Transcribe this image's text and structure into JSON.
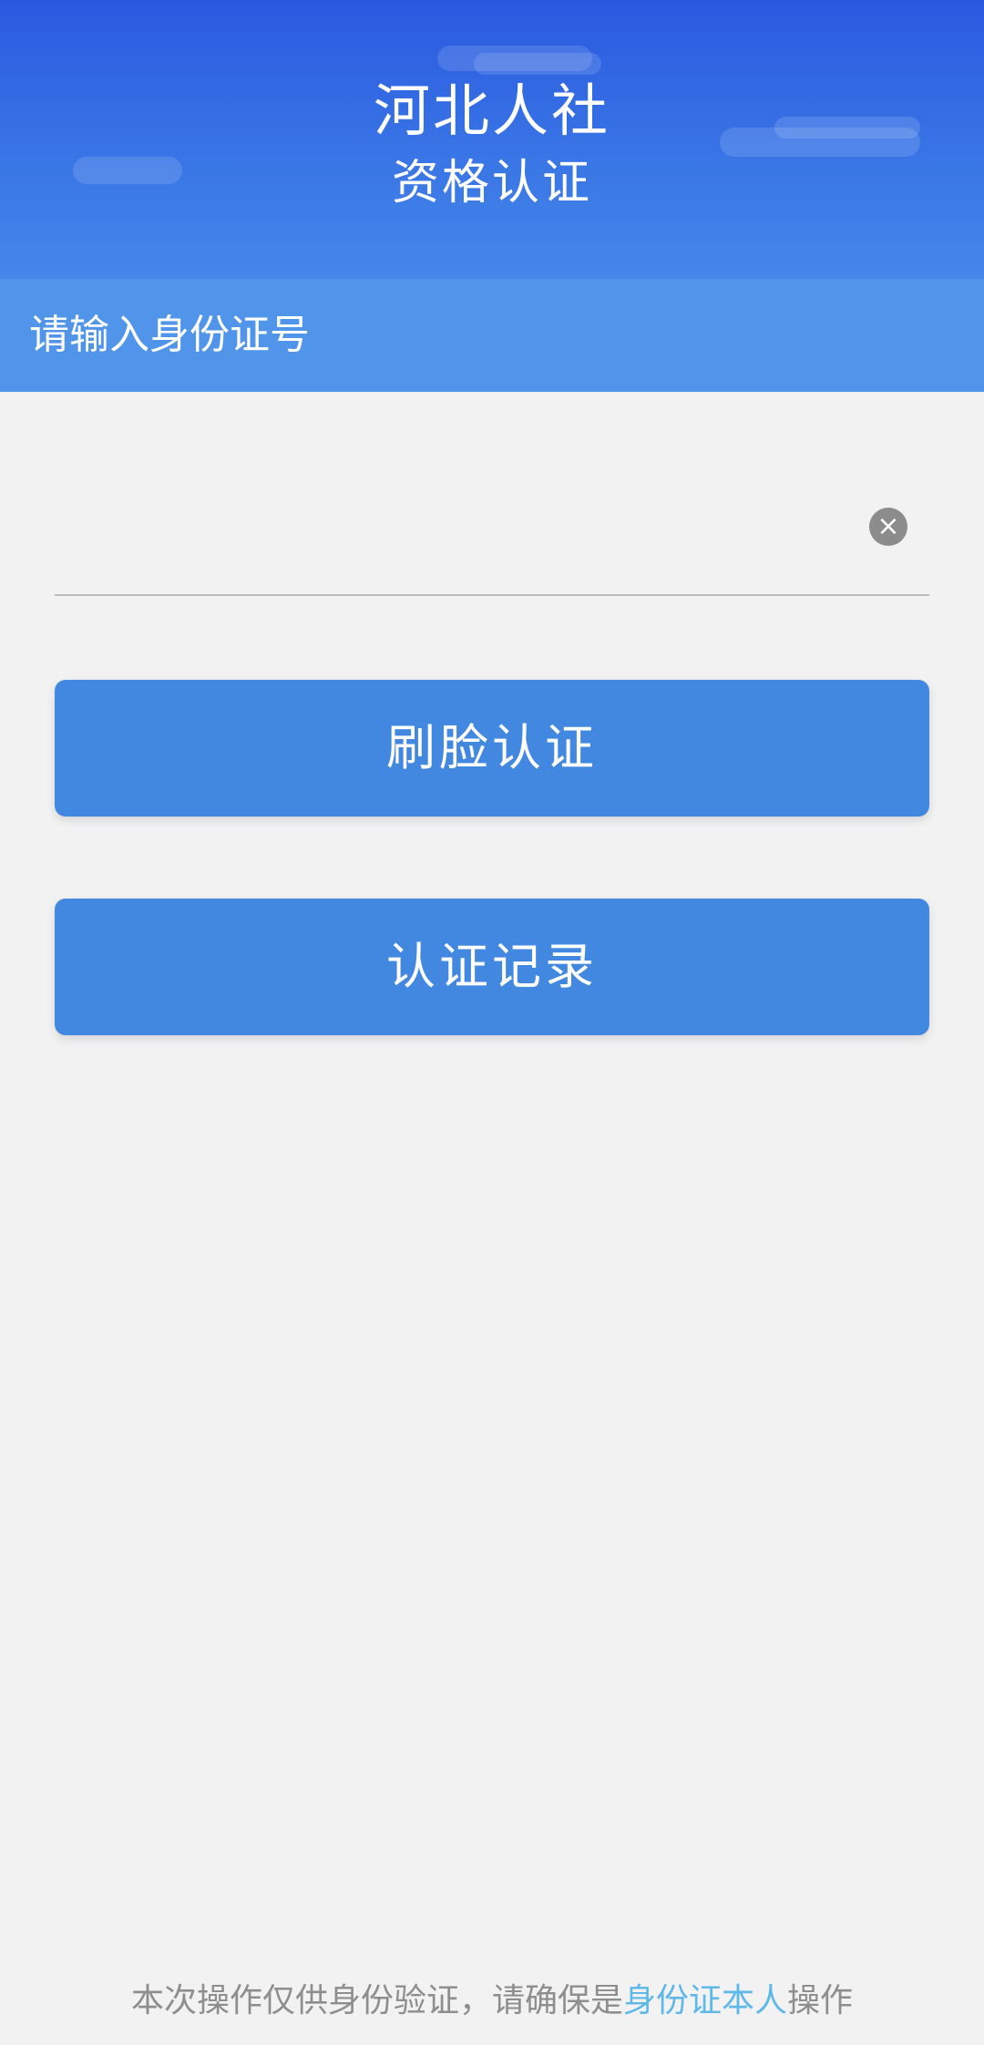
{
  "header": {
    "title": "河北人社",
    "subtitle": "资格认证"
  },
  "id_input": {
    "label": "请输入身份证号",
    "value": "",
    "placeholder": ""
  },
  "buttons": {
    "clear_icon": "×",
    "face_auth": "刷脸认证",
    "records": "认证记录"
  },
  "footer": {
    "text_before": "本次操作仅供身份验证，请确保是",
    "link_text": "身份证本人",
    "text_after": "操作"
  },
  "colors": {
    "header_top": "#2a59e0",
    "banner": "#5095ea",
    "button": "#4388e0",
    "link": "#5eb8e8",
    "background": "#f2f2f3"
  }
}
